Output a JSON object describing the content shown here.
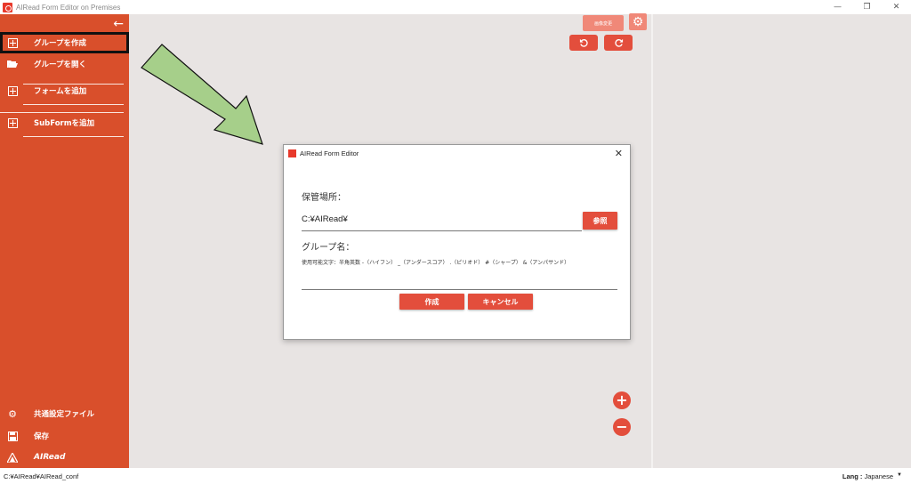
{
  "window": {
    "title": "AIRead Form Editor on Premises",
    "minimize": "—",
    "restore": "❐",
    "close": "✕"
  },
  "sidebar": {
    "back_icon": "arrow-left-icon",
    "items": [
      {
        "label": "グループを作成",
        "icon": "plus-box-icon"
      },
      {
        "label": "グループを開く",
        "icon": "folder-open-icon"
      },
      {
        "label": "フォームを追加",
        "icon": "plus-box-icon"
      },
      {
        "label": "SubFormを追加",
        "icon": "plus-box-icon"
      }
    ],
    "bottom_items": [
      {
        "label": "共通設定ファイル",
        "icon": "gear-icon"
      },
      {
        "label": "保存",
        "icon": "save-icon"
      }
    ],
    "brand": "AIRead"
  },
  "toolbar": {
    "faded_button_label": "画像変更"
  },
  "dialog": {
    "title": "AIRead Form Editor",
    "storage_label": "保管場所：",
    "storage_value": "C:¥AIRead¥",
    "browse_button": "参照",
    "group_label": "グループ名：",
    "group_hint": "使用可能文字：半角英数 -（ハイフン） _（アンダースコア） .（ピリオド） #（シャープ） &（アンパサンド）",
    "group_value": "",
    "create_button": "作成",
    "cancel_button": "キャンセル"
  },
  "statusbar": {
    "path": "C:¥AIRead¥AIRead_conf",
    "lang_label": "Lang :",
    "lang_value": "Japanese"
  },
  "colors": {
    "sidebar": "#d94f2b",
    "accent": "#e34e3c",
    "arrow": "#a6cf8a",
    "background": "#e8e4e3"
  }
}
